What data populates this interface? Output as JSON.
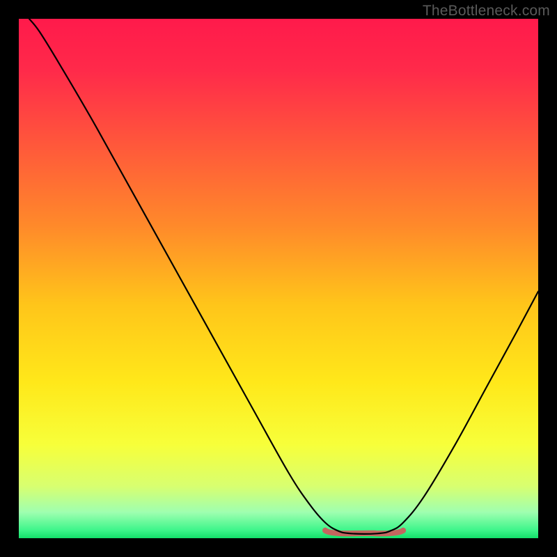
{
  "watermark": "TheBottleneck.com",
  "chart_data": {
    "type": "line",
    "title": "",
    "xlabel": "",
    "ylabel": "",
    "xlim": [
      0,
      100
    ],
    "ylim": [
      0,
      100
    ],
    "gradient_stops": [
      {
        "offset": 0.0,
        "color": "#ff1a4b"
      },
      {
        "offset": 0.1,
        "color": "#ff2a4a"
      },
      {
        "offset": 0.25,
        "color": "#ff5a3a"
      },
      {
        "offset": 0.4,
        "color": "#ff8a2a"
      },
      {
        "offset": 0.55,
        "color": "#ffc51a"
      },
      {
        "offset": 0.7,
        "color": "#ffe81a"
      },
      {
        "offset": 0.82,
        "color": "#f7ff3a"
      },
      {
        "offset": 0.9,
        "color": "#d8ff70"
      },
      {
        "offset": 0.95,
        "color": "#9fffb0"
      },
      {
        "offset": 0.985,
        "color": "#3cf58a"
      },
      {
        "offset": 1.0,
        "color": "#13e06a"
      }
    ],
    "series": [
      {
        "name": "bottleneck-curve",
        "color": "#000000",
        "width": 2.2,
        "points": [
          {
            "x": 2.0,
            "y": 100.0
          },
          {
            "x": 4.0,
            "y": 97.5
          },
          {
            "x": 8.0,
            "y": 91.0
          },
          {
            "x": 15.0,
            "y": 79.0
          },
          {
            "x": 25.0,
            "y": 61.0
          },
          {
            "x": 35.0,
            "y": 43.0
          },
          {
            "x": 45.0,
            "y": 25.0
          },
          {
            "x": 52.0,
            "y": 12.5
          },
          {
            "x": 56.0,
            "y": 6.5
          },
          {
            "x": 59.0,
            "y": 3.0
          },
          {
            "x": 61.5,
            "y": 1.4
          },
          {
            "x": 64.0,
            "y": 0.9
          },
          {
            "x": 69.0,
            "y": 0.9
          },
          {
            "x": 71.5,
            "y": 1.4
          },
          {
            "x": 74.0,
            "y": 3.0
          },
          {
            "x": 78.0,
            "y": 8.0
          },
          {
            "x": 84.0,
            "y": 18.0
          },
          {
            "x": 90.0,
            "y": 29.0
          },
          {
            "x": 96.0,
            "y": 40.0
          },
          {
            "x": 100.0,
            "y": 47.5
          }
        ]
      }
    ],
    "valley_band": {
      "color": "#c4665f",
      "x_start": 59.0,
      "x_end": 74.0,
      "y": 1.05,
      "thickness_pct": 1.1
    }
  }
}
